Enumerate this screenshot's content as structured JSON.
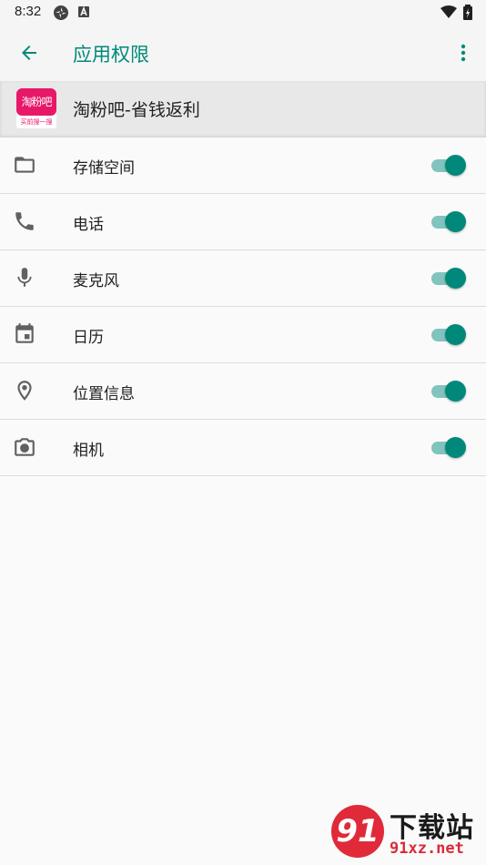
{
  "status_bar": {
    "time": "8:32"
  },
  "app_bar": {
    "title": "应用权限"
  },
  "app": {
    "name": "淘粉吧-省钱返利",
    "logo_text": "淘粉吧",
    "logo_subtext": "买前搜一搜"
  },
  "permissions": [
    {
      "label": "存储空间",
      "icon": "folder-icon",
      "enabled": true
    },
    {
      "label": "电话",
      "icon": "phone-icon",
      "enabled": true
    },
    {
      "label": "麦克风",
      "icon": "mic-icon",
      "enabled": true
    },
    {
      "label": "日历",
      "icon": "calendar-icon",
      "enabled": true
    },
    {
      "label": "位置信息",
      "icon": "location-icon",
      "enabled": true
    },
    {
      "label": "相机",
      "icon": "camera-icon",
      "enabled": true
    }
  ],
  "watermark": {
    "logo": "91",
    "title": "下载站",
    "url": "91xz.net"
  },
  "colors": {
    "accent": "#00897b",
    "track": "#80c4bd",
    "logo_pink": "#e81869"
  }
}
